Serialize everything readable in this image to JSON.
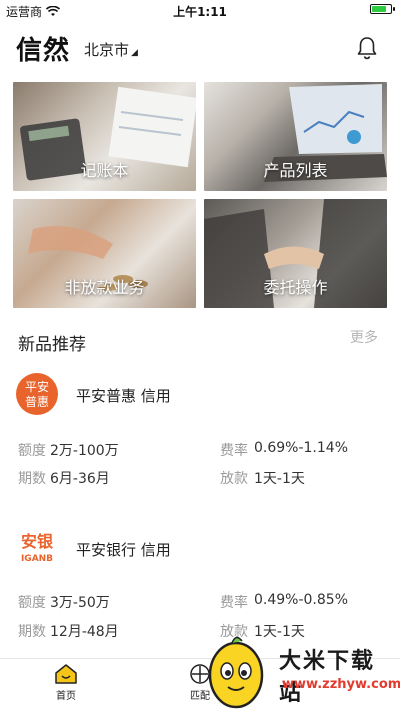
{
  "status_bar": {
    "carrier": "运营商",
    "time": "上午1:11",
    "battery_level": 0.85
  },
  "header": {
    "logo_text": "信然",
    "city": "北京市",
    "notification_icon": "bell-icon"
  },
  "tiles": [
    {
      "label": "记账本"
    },
    {
      "label": "产品列表"
    },
    {
      "label": "非放款业务"
    },
    {
      "label": "委托操作"
    }
  ],
  "section": {
    "title": "新品推荐",
    "more": "更多"
  },
  "products": [
    {
      "logo_line1": "平安",
      "logo_line2": "普惠",
      "name": "平安普惠 信用",
      "amount_key": "额度",
      "amount": "2万-100万",
      "rate_key": "费率",
      "rate": "0.69%-1.14%",
      "term_key": "期数",
      "term": "6月-36月",
      "disburse_key": "放款",
      "disburse": "1天-1天"
    },
    {
      "logo_line1": "安银",
      "logo_line2": "IGANB",
      "name": "平安银行 信用",
      "amount_key": "额度",
      "amount": "3万-50万",
      "rate_key": "费率",
      "rate": "0.49%-0.85%",
      "term_key": "期数",
      "term": "12月-48月",
      "disburse_key": "放款",
      "disburse": "1天-1天"
    }
  ],
  "tabbar": {
    "home": "首页",
    "match": "匹配"
  },
  "watermark": {
    "title": "大米下载站",
    "url": "www.zzhyw.com"
  },
  "colors": {
    "accent": "#f5c518",
    "brand_orange": "#e8642c",
    "muted": "#9a9a9a"
  }
}
